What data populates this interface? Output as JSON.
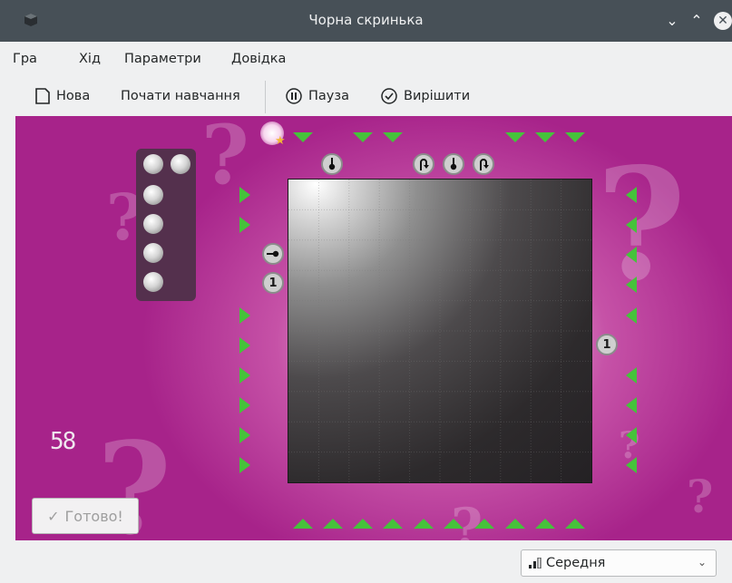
{
  "window": {
    "title": "Чорна скринька"
  },
  "menu": {
    "game": "Гра",
    "move": "Хід",
    "settings": "Параметри",
    "help": "Довідка"
  },
  "toolbar": {
    "new": "Нова",
    "tutorial": "Почати навчання",
    "pause": "Пауза",
    "solve": "Вирішити"
  },
  "board": {
    "counter": "58",
    "done_label": "Готово!",
    "markers": {
      "left_number": "1",
      "right_number": "1"
    },
    "remaining_balls": 6
  },
  "status": {
    "difficulty": "Середня"
  },
  "colors": {
    "board_bg": "#a7238a",
    "arrow_green": "#46c23b",
    "titlebar": "#475057"
  },
  "icons": [
    "app-icon",
    "minimize-icon",
    "maximize-icon",
    "close-icon",
    "new-document-icon",
    "pause-icon",
    "check-circle-icon",
    "signal-icon",
    "chevron-down-icon",
    "checkmark-icon"
  ]
}
